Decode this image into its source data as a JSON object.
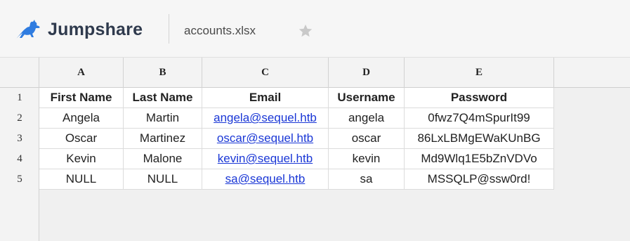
{
  "app": {
    "brand_name": "Jumpshare",
    "brand_logo_icon": "kangaroo-logo-icon",
    "brand_color": "#2f7ce0",
    "file_name": "accounts.xlsx",
    "star_icon": "star-icon",
    "star_color": "#c9c9c9"
  },
  "sheet": {
    "column_headers": [
      "A",
      "B",
      "C",
      "D",
      "E"
    ],
    "row_numbers": [
      "1",
      "2",
      "3",
      "4",
      "5"
    ],
    "header_row": [
      "First Name",
      "Last Name",
      "Email",
      "Username",
      "Password"
    ],
    "rows": [
      [
        "Angela",
        "Martin",
        "angela@sequel.htb",
        "angela",
        "0fwz7Q4mSpurIt99"
      ],
      [
        "Oscar",
        "Martinez",
        "oscar@sequel.htb",
        "oscar",
        "86LxLBMgEWaKUnBG"
      ],
      [
        "Kevin",
        "Malone",
        "kevin@sequel.htb",
        "kevin",
        "Md9Wlq1E5bZnVDVo"
      ],
      [
        "NULL",
        "NULL",
        "sa@sequel.htb",
        "sa",
        "MSSQLP@ssw0rd!"
      ]
    ],
    "link_color": "#1a37d6"
  }
}
